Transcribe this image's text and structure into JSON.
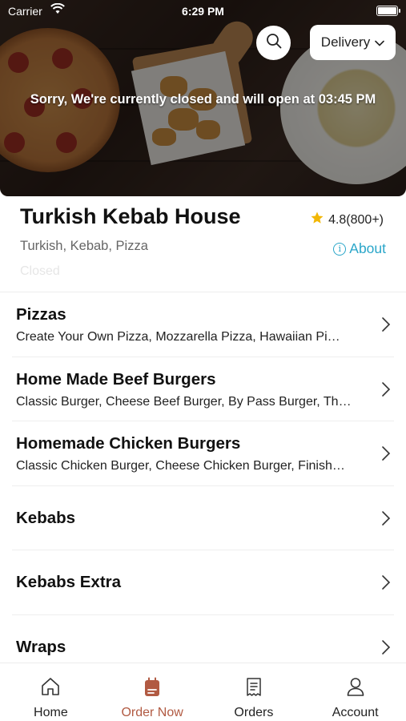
{
  "status_bar": {
    "carrier": "Carrier",
    "time": "6:29 PM"
  },
  "hero": {
    "order_mode": "Delivery",
    "closed_message": "Sorry, We're currently closed and will open at 03:45 PM"
  },
  "restaurant": {
    "name": "Turkish Kebab House",
    "rating": "4.8(800+)",
    "cuisines": "Turkish, Kebab, Pizza",
    "about_label": "About",
    "status_text": "Closed",
    "accent_color": "#2aa6c9",
    "star_color": "#f2b705"
  },
  "menu": {
    "categories": [
      {
        "title": "Pizzas",
        "items": "Create Your Own Pizza, Mozzarella Pizza, Hawaiian Pi…"
      },
      {
        "title": "Home Made Beef Burgers",
        "items": "Classic Burger, Cheese Beef Burger, By Pass Burger, Th…"
      },
      {
        "title": "Homemade Chicken Burgers",
        "items": "Classic Chicken Burger, Cheese Chicken Burger, Finish…"
      },
      {
        "title": "Kebabs",
        "items": ""
      },
      {
        "title": "Kebabs Extra",
        "items": ""
      },
      {
        "title": "Wraps",
        "items": ""
      }
    ]
  },
  "tabbar": {
    "active_color": "#b15a42",
    "tabs": [
      {
        "label": "Home",
        "icon": "home-icon"
      },
      {
        "label": "Order Now",
        "icon": "order-bag-icon"
      },
      {
        "label": "Orders",
        "icon": "receipt-icon"
      },
      {
        "label": "Account",
        "icon": "person-icon"
      }
    ]
  }
}
